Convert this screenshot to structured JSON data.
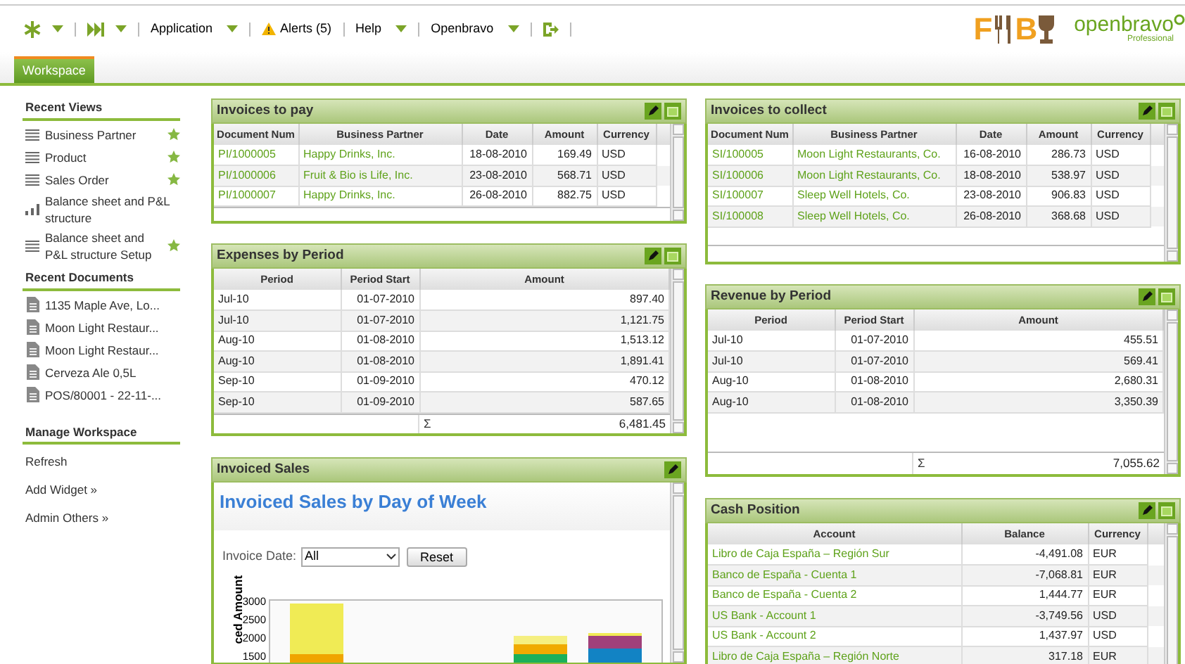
{
  "toolbar": {
    "items": [
      {
        "kind": "star-menu"
      },
      {
        "kind": "forward-menu"
      },
      {
        "kind": "menu",
        "label": "Application"
      },
      {
        "kind": "alert",
        "label": "Alerts (5)"
      },
      {
        "kind": "menu",
        "label": "Help"
      },
      {
        "kind": "menu",
        "label": "Openbravo"
      },
      {
        "kind": "logout"
      }
    ],
    "logo": {
      "letters": [
        "F",
        "B"
      ],
      "brand": "openbravo",
      "edition": "Professional"
    }
  },
  "tabs": [
    {
      "label": "Workspace",
      "selected": true
    }
  ],
  "sidebar": [
    {
      "title": "Recent Views",
      "items": [
        {
          "label": "Business Partner",
          "kind": "list",
          "favorite": true
        },
        {
          "label": "Product",
          "kind": "list",
          "favorite": true
        },
        {
          "label": "Sales Order",
          "kind": "list",
          "favorite": true
        },
        {
          "label": "Balance sheet and P&L structure",
          "kind": "chart",
          "favorite": false
        },
        {
          "label": "Balance sheet and P&L structure Setup",
          "kind": "list",
          "favorite": true
        }
      ]
    },
    {
      "title": "Recent Documents",
      "items": [
        {
          "label": "1135 Maple Ave, Lo...",
          "kind": "document",
          "favorite": false
        },
        {
          "label": "Moon Light Restaur...",
          "kind": "document",
          "favorite": false
        },
        {
          "label": "Moon Light Restaur...",
          "kind": "document",
          "favorite": false
        },
        {
          "label": "Cerveza Ale 0,5L",
          "kind": "document",
          "favorite": false
        },
        {
          "label": "POS/80001 - 22-11-...",
          "kind": "document",
          "favorite": false
        }
      ]
    },
    {
      "title": "Manage Workspace",
      "items": [
        {
          "label": "Refresh",
          "kind": "action",
          "favorite": false
        },
        {
          "label": "Add Widget »",
          "kind": "action",
          "favorite": false
        },
        {
          "label": "Admin Others »",
          "kind": "action",
          "favorite": false
        }
      ]
    }
  ],
  "widget_columns": [
    [
      {
        "kind": "invoices",
        "title": "Invoices to pay",
        "maximize": true,
        "columns": [
          {
            "label": "Document Num",
            "kind": "link"
          },
          {
            "label": "Business Partner",
            "kind": "link"
          },
          {
            "label": "Date",
            "kind": "number"
          },
          {
            "label": "Amount",
            "kind": "number"
          },
          {
            "label": "Currency",
            "kind": "text"
          }
        ],
        "rows": [
          [
            "PI/1000005",
            "Happy Drinks, Inc.",
            "18-08-2010",
            "169.49",
            "USD"
          ],
          [
            "PI/1000006",
            "Fruit & Bio is Life, Inc.",
            "23-08-2010",
            "568.71",
            "USD"
          ],
          [
            "PI/1000007",
            "Happy Drinks, Inc.",
            "26-08-2010",
            "882.75",
            "USD"
          ]
        ]
      },
      {
        "kind": "period",
        "title": "Expenses by Period",
        "maximize": true,
        "columns": [
          {
            "label": "Period",
            "kind": "text"
          },
          {
            "label": "Period Start",
            "kind": "number"
          },
          {
            "label": "Amount",
            "kind": "number"
          }
        ],
        "rows": [
          [
            "Jul-10",
            "01-07-2010",
            "897.40"
          ],
          [
            "Jul-10",
            "01-07-2010",
            "1,121.75"
          ],
          [
            "Aug-10",
            "01-08-2010",
            "1,513.12"
          ],
          [
            "Aug-10",
            "01-08-2010",
            "1,891.41"
          ],
          [
            "Sep-10",
            "01-09-2010",
            "470.12"
          ],
          [
            "Sep-10",
            "01-09-2010",
            "587.65"
          ]
        ],
        "total": {
          "symbol": "Σ",
          "value": "6,481.45"
        }
      },
      {
        "kind": "chart",
        "title": "Invoiced Sales",
        "maximize": false,
        "chart_title": "Invoiced Sales by Day of Week",
        "filter_label": "Invoice Date:",
        "filter_value": "All",
        "button": "Reset",
        "ylabel": "ced Amount",
        "yticks": [
          "3000",
          "2500",
          "2000",
          "1500"
        ]
      }
    ],
    [
      {
        "kind": "invoices",
        "title": "Invoices to collect",
        "maximize": true,
        "columns": [
          {
            "label": "Document Num",
            "kind": "link"
          },
          {
            "label": "Business Partner",
            "kind": "link"
          },
          {
            "label": "Date",
            "kind": "number"
          },
          {
            "label": "Amount",
            "kind": "number"
          },
          {
            "label": "Currency",
            "kind": "text"
          }
        ],
        "rows": [
          [
            "SI/100005",
            "Moon Light Restaurants, Co.",
            "16-08-2010",
            "286.73",
            "USD"
          ],
          [
            "SI/100006",
            "Moon Light Restaurants, Co.",
            "18-08-2010",
            "538.97",
            "USD"
          ],
          [
            "SI/100007",
            "Sleep Well Hotels, Co.",
            "23-08-2010",
            "906.83",
            "USD"
          ],
          [
            "SI/100008",
            "Sleep Well Hotels, Co.",
            "26-08-2010",
            "368.68",
            "USD"
          ]
        ]
      },
      {
        "kind": "period",
        "title": "Revenue by Period",
        "maximize": true,
        "columns": [
          {
            "label": "Period",
            "kind": "text"
          },
          {
            "label": "Period Start",
            "kind": "number"
          },
          {
            "label": "Amount",
            "kind": "number"
          }
        ],
        "rows": [
          [
            "Jul-10",
            "01-07-2010",
            "455.51"
          ],
          [
            "Jul-10",
            "01-07-2010",
            "569.41"
          ],
          [
            "Aug-10",
            "01-08-2010",
            "2,680.31"
          ],
          [
            "Aug-10",
            "01-08-2010",
            "3,350.39"
          ]
        ],
        "total": {
          "symbol": "Σ",
          "value": "7,055.62"
        }
      },
      {
        "kind": "cash",
        "title": "Cash Position",
        "maximize": true,
        "columns": [
          {
            "label": "Account",
            "kind": "link"
          },
          {
            "label": "Balance",
            "kind": "number"
          },
          {
            "label": "Currency",
            "kind": "text"
          }
        ],
        "rows": [
          [
            "Libro de Caja España – Región Sur",
            "-4,491.08",
            "EUR"
          ],
          [
            "Banco de España - Cuenta 1",
            "-7,068.81",
            "EUR"
          ],
          [
            "Banco de España - Cuenta 2",
            "1,444.77",
            "EUR"
          ],
          [
            "US Bank - Account 1",
            "-3,749.56",
            "USD"
          ],
          [
            "US Bank - Account 2",
            "1,437.97",
            "USD"
          ],
          [
            "Libro de Caja España – Región Norte",
            "317.18",
            "EUR"
          ]
        ]
      }
    ]
  ]
}
